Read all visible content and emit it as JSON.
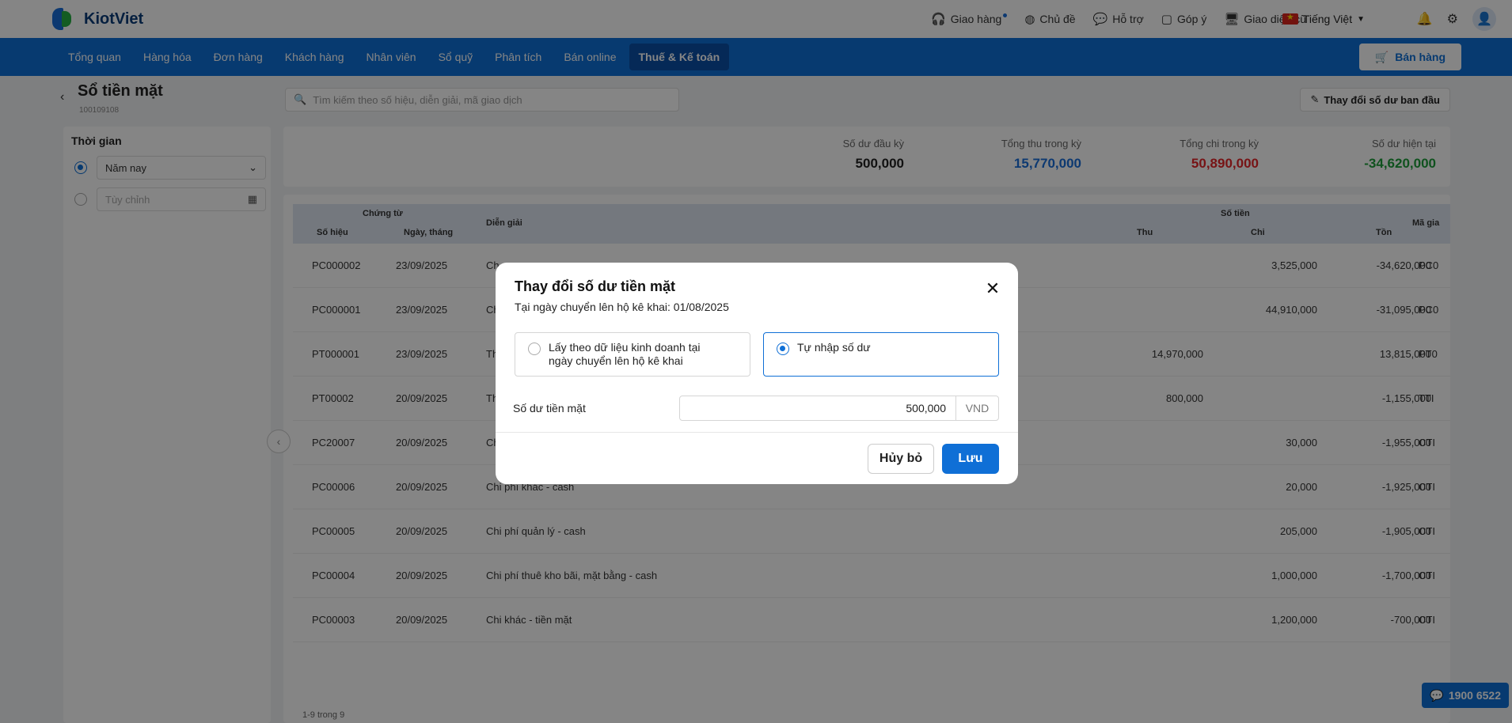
{
  "app": {
    "logo_text": "KiotViet"
  },
  "topbar": {
    "links": [
      {
        "label": "Giao hàng",
        "icon": "headset-icon"
      },
      {
        "label": "Chủ đề",
        "icon": "palette-icon"
      },
      {
        "label": "Hỗ trợ",
        "icon": "chat-icon"
      },
      {
        "label": "Góp ý",
        "icon": "feedback-icon"
      },
      {
        "label": "Giao diện cũ",
        "icon": "monitor-icon"
      }
    ],
    "language": "Tiếng Việt"
  },
  "nav": {
    "items": [
      "Tổng quan",
      "Hàng hóa",
      "Đơn hàng",
      "Khách hàng",
      "Nhân viên",
      "Sổ quỹ",
      "Phân tích",
      "Bán online",
      "Thuế & Kế toán"
    ],
    "active": "Thuế & Kế toán",
    "sell_label": "Bán hàng"
  },
  "page": {
    "title": "Sổ tiền mặt",
    "subtitle": "100109108",
    "search_placeholder": "Tìm kiếm theo số hiệu, diễn giải, mã giao dịch",
    "change_button": "Thay đổi số dư ban đầu"
  },
  "filter": {
    "title": "Thời gian",
    "option_year": "Năm nay",
    "option_custom": "Tùy chỉnh"
  },
  "summary": [
    {
      "label": "Số dư đầu kỳ",
      "value": "500,000",
      "color": "#222222"
    },
    {
      "label": "Tổng thu trong kỳ",
      "value": "15,770,000",
      "color": "#1a6ed8"
    },
    {
      "label": "Tổng chi trong kỳ",
      "value": "50,890,000",
      "color": "#e5252a"
    },
    {
      "label": "Số dư hiện tại",
      "value": "-34,620,000",
      "color": "#1e9e3a"
    }
  ],
  "table": {
    "group_voucher": "Chứng từ",
    "group_amount": "Số tiền",
    "col_number": "Số hiệu",
    "col_date": "Ngày, tháng",
    "col_desc": "Diễn giải",
    "col_in": "Thu",
    "col_out": "Chi",
    "col_balance": "Tồn",
    "col_code": "Mã gia",
    "rows": [
      {
        "no": "PC000002",
        "date": "23/09/2025",
        "desc": "Ch",
        "in": "",
        "out": "3,525,000",
        "bal": "-34,620,000",
        "code": "PC0"
      },
      {
        "no": "PC000001",
        "date": "23/09/2025",
        "desc": "Ch",
        "in": "",
        "out": "44,910,000",
        "bal": "-31,095,000",
        "code": "PC0"
      },
      {
        "no": "PT000001",
        "date": "23/09/2025",
        "desc": "Th",
        "in": "14,970,000",
        "out": "",
        "bal": "13,815,000",
        "code": "PT0"
      },
      {
        "no": "PT00002",
        "date": "20/09/2025",
        "desc": "Th",
        "in": "800,000",
        "out": "",
        "bal": "-1,155,000",
        "code": "TTI"
      },
      {
        "no": "PC20007",
        "date": "20/09/2025",
        "desc": "Ch",
        "in": "",
        "out": "30,000",
        "bal": "-1,955,000",
        "code": "CTI"
      },
      {
        "no": "PC00006",
        "date": "20/09/2025",
        "desc": "Chi phí khác - cash",
        "in": "",
        "out": "20,000",
        "bal": "-1,925,000",
        "code": "CTI"
      },
      {
        "no": "PC00005",
        "date": "20/09/2025",
        "desc": "Chi phí quản lý - cash",
        "in": "",
        "out": "205,000",
        "bal": "-1,905,000",
        "code": "CTI"
      },
      {
        "no": "PC00004",
        "date": "20/09/2025",
        "desc": "Chi phí thuê kho bãi, mặt bằng - cash",
        "in": "",
        "out": "1,000,000",
        "bal": "-1,700,000",
        "code": "CTI"
      },
      {
        "no": "PC00003",
        "date": "20/09/2025",
        "desc": "Chi khác - tiền mặt",
        "in": "",
        "out": "1,200,000",
        "bal": "-700,000",
        "code": "CTI"
      }
    ],
    "footer": "1-9 trong 9"
  },
  "hotline": "1900 6522",
  "modal": {
    "title": "Thay đổi số dư tiền mặt",
    "subtitle": "Tại ngày chuyển lên hộ kê khai: 01/08/2025",
    "option1_line1": "Lấy theo dữ liệu kinh doanh tại",
    "option1_line2": "ngày chuyển lên hộ kê khai",
    "option2": "Tự nhập số dư",
    "field_label": "Số dư tiền mặt",
    "field_value": "500,000",
    "field_unit": "VND",
    "cancel_label": "Hủy bỏ",
    "save_label": "Lưu"
  }
}
